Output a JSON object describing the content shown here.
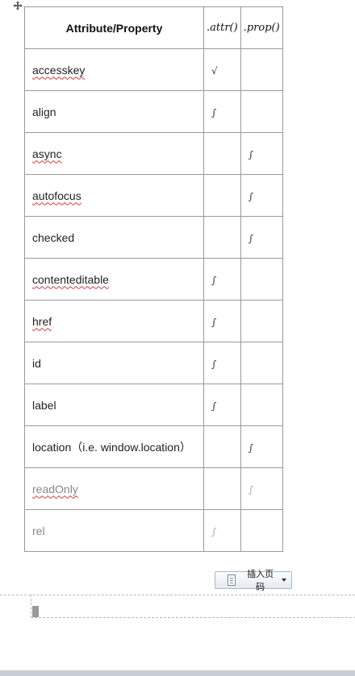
{
  "table": {
    "headers": [
      "Attribute/Property",
      ".attr()",
      ".prop()"
    ],
    "rows": [
      {
        "name": "accesskey",
        "attr": "√",
        "prop": "",
        "spell": true,
        "faded": false
      },
      {
        "name": "align",
        "attr": "∫",
        "prop": "",
        "spell": false,
        "faded": false
      },
      {
        "name": "async",
        "attr": "",
        "prop": "∫",
        "spell": true,
        "faded": false
      },
      {
        "name": "autofocus",
        "attr": "",
        "prop": "∫",
        "spell": true,
        "faded": false
      },
      {
        "name": "checked",
        "attr": "",
        "prop": "∫",
        "spell": false,
        "faded": false
      },
      {
        "name": "contenteditable",
        "attr": "∫",
        "prop": "",
        "spell": true,
        "faded": false
      },
      {
        "name": "href",
        "attr": "∫",
        "prop": "",
        "spell": true,
        "faded": false
      },
      {
        "name": "id",
        "attr": "∫",
        "prop": "",
        "spell": false,
        "faded": false
      },
      {
        "name": "label",
        "attr": "∫",
        "prop": "",
        "spell": false,
        "faded": false
      },
      {
        "name": "location（i.e. window.location）",
        "attr": "",
        "prop": "∫",
        "spell": false,
        "faded": false
      },
      {
        "name": "readOnly",
        "attr": "",
        "prop": "∫",
        "spell": true,
        "faded": true
      },
      {
        "name": "rel",
        "attr": "∫",
        "prop": "",
        "spell": false,
        "faded": true
      }
    ]
  },
  "insert_page_button": {
    "label": "插入页码"
  },
  "icons": {
    "move_handle": "move-arrows-icon",
    "insert_page": "page-document-icon",
    "dropdown": "chevron-down-icon"
  }
}
